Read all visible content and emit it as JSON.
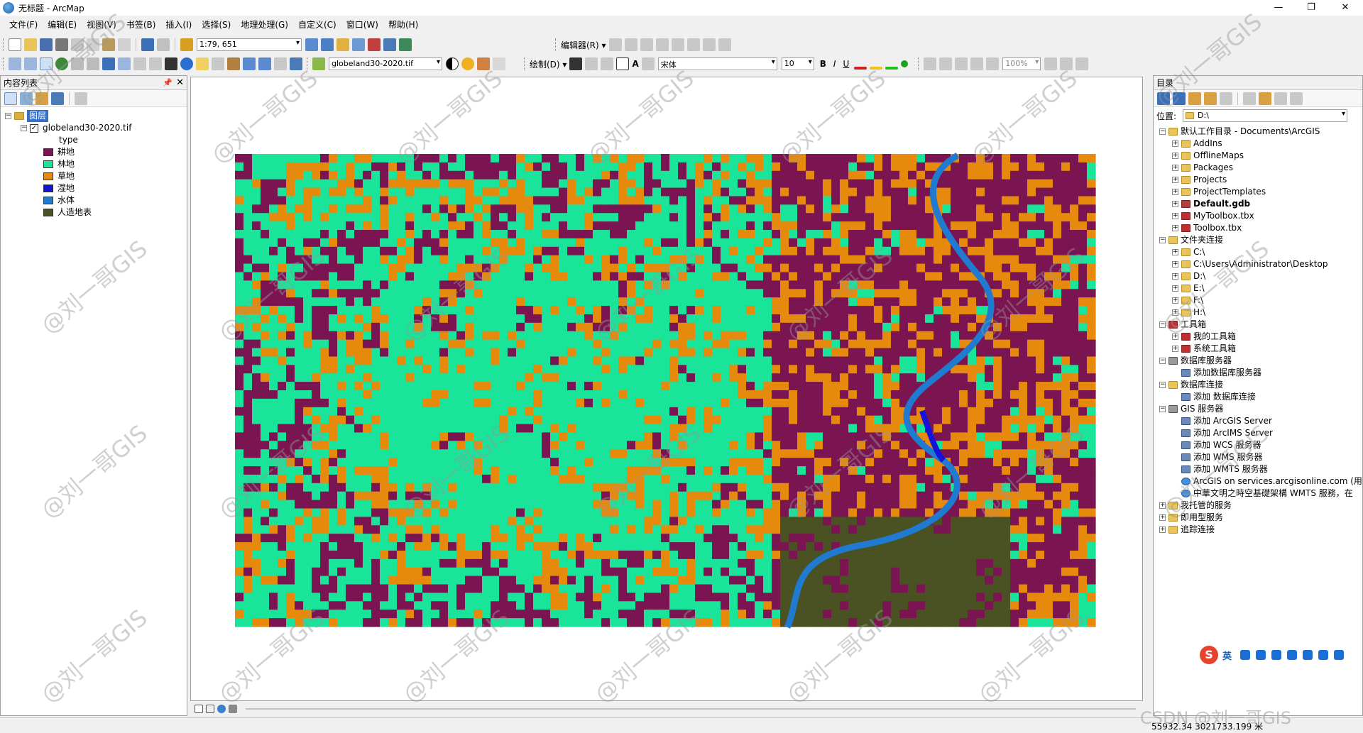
{
  "window": {
    "title": "无标题 - ArcMap",
    "minimize": "—",
    "maximize": "❐",
    "close": "✕"
  },
  "menu": [
    "文件(F)",
    "编辑(E)",
    "视图(V)",
    "书签(B)",
    "插入(I)",
    "选择(S)",
    "地理处理(G)",
    "自定义(C)",
    "窗口(W)",
    "帮助(H)"
  ],
  "toolbar": {
    "scale": "1:79, 651",
    "editor_label": "编辑器(R) ▾",
    "layer_combo": "globeland30-2020.tif",
    "draw_label": "绘制(D) ▾",
    "font_name": "宋体",
    "font_size": "10",
    "bold": "B",
    "italic": "I",
    "underline": "U",
    "zoom_level": "100%"
  },
  "toc": {
    "title": "内容列表",
    "pin": "📌",
    "close": "✕",
    "root": "图层",
    "layer": "globeland30-2020.tif",
    "field": "type",
    "legend": [
      {
        "label": "耕地",
        "color": "#7b1552"
      },
      {
        "label": "林地",
        "color": "#1ae39a"
      },
      {
        "label": "草地",
        "color": "#e68a0e"
      },
      {
        "label": "湿地",
        "color": "#1414d8"
      },
      {
        "label": "水体",
        "color": "#1f7ad0"
      },
      {
        "label": "人造地表",
        "color": "#4a5224"
      }
    ]
  },
  "catalog": {
    "title": "目录",
    "location_label": "位置:",
    "location_value": "D:\\",
    "items": [
      {
        "label": "默认工作目录 - Documents\\ArcGIS",
        "level": 0,
        "exp": "⊟",
        "icon": "folder"
      },
      {
        "label": "AddIns",
        "level": 1,
        "exp": "⊞",
        "icon": "folder"
      },
      {
        "label": "OfflineMaps",
        "level": 1,
        "exp": "⊞",
        "icon": "folder"
      },
      {
        "label": "Packages",
        "level": 1,
        "exp": "⊞",
        "icon": "folder"
      },
      {
        "label": "Projects",
        "level": 1,
        "exp": "⊞",
        "icon": "folder"
      },
      {
        "label": "ProjectTemplates",
        "level": 1,
        "exp": "⊞",
        "icon": "folder"
      },
      {
        "label": "Default.gdb",
        "level": 1,
        "exp": "⊞",
        "icon": "gdb",
        "bold": true
      },
      {
        "label": "MyToolbox.tbx",
        "level": 1,
        "exp": "⊞",
        "icon": "toolbox"
      },
      {
        "label": "Toolbox.tbx",
        "level": 1,
        "exp": "⊞",
        "icon": "toolbox"
      },
      {
        "label": "文件夹连接",
        "level": 0,
        "exp": "⊟",
        "icon": "folder"
      },
      {
        "label": "C:\\",
        "level": 1,
        "exp": "⊞",
        "icon": "folder"
      },
      {
        "label": "C:\\Users\\Administrator\\Desktop",
        "level": 1,
        "exp": "⊞",
        "icon": "folder"
      },
      {
        "label": "D:\\",
        "level": 1,
        "exp": "⊞",
        "icon": "folder"
      },
      {
        "label": "E:\\",
        "level": 1,
        "exp": "⊞",
        "icon": "folder"
      },
      {
        "label": "F:\\",
        "level": 1,
        "exp": "⊞",
        "icon": "folder"
      },
      {
        "label": "H:\\",
        "level": 1,
        "exp": "⊞",
        "icon": "folder"
      },
      {
        "label": "工具箱",
        "level": 0,
        "exp": "⊟",
        "icon": "toolbox"
      },
      {
        "label": "我的工具箱",
        "level": 1,
        "exp": "⊞",
        "icon": "toolbox"
      },
      {
        "label": "系统工具箱",
        "level": 1,
        "exp": "⊞",
        "icon": "toolbox"
      },
      {
        "label": "数据库服务器",
        "level": 0,
        "exp": "⊟",
        "icon": "server"
      },
      {
        "label": "添加数据库服务器",
        "level": 1,
        "exp": "",
        "icon": "add"
      },
      {
        "label": "数据库连接",
        "level": 0,
        "exp": "⊟",
        "icon": "folder"
      },
      {
        "label": "添加 数据库连接",
        "level": 1,
        "exp": "",
        "icon": "add"
      },
      {
        "label": "GIS 服务器",
        "level": 0,
        "exp": "⊟",
        "icon": "server"
      },
      {
        "label": "添加 ArcGIS Server",
        "level": 1,
        "exp": "",
        "icon": "add"
      },
      {
        "label": "添加 ArcIMS Server",
        "level": 1,
        "exp": "",
        "icon": "add"
      },
      {
        "label": "添加 WCS 服务器",
        "level": 1,
        "exp": "",
        "icon": "add"
      },
      {
        "label": "添加 WMS 服务器",
        "level": 1,
        "exp": "",
        "icon": "add"
      },
      {
        "label": "添加 WMTS 服务器",
        "level": 1,
        "exp": "",
        "icon": "add"
      },
      {
        "label": "ArcGIS on services.arcgisonline.com (用",
        "level": 1,
        "exp": "",
        "icon": "globe"
      },
      {
        "label": "中華文明之時空基礎架構 WMTS 服務，在",
        "level": 1,
        "exp": "",
        "icon": "globe"
      },
      {
        "label": "我托管的服务",
        "level": 0,
        "exp": "⊞",
        "icon": "folder"
      },
      {
        "label": "即用型服务",
        "level": 0,
        "exp": "⊞",
        "icon": "folder"
      },
      {
        "label": "追踪连接",
        "level": 0,
        "exp": "⊞",
        "icon": "folder"
      }
    ]
  },
  "ime": {
    "logo": "S",
    "lang": "英"
  },
  "status": {
    "coordinates": "55932.34  3021733.199 米"
  },
  "watermarks": {
    "text": "@刘一哥GIS",
    "footer": "CSDN @刘一哥GIS"
  }
}
